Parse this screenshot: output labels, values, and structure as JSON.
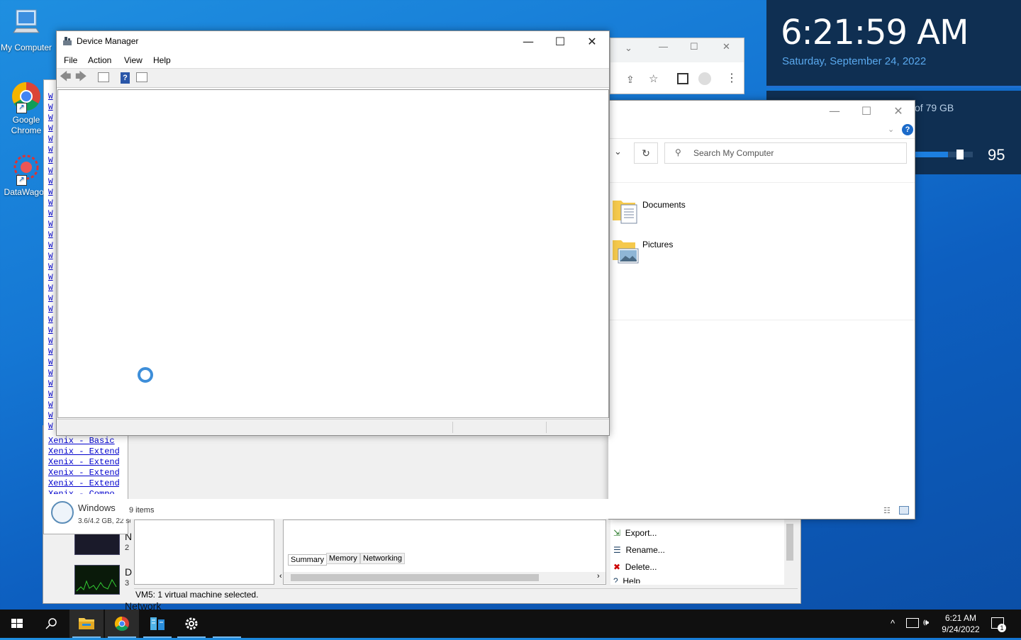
{
  "desktop": {
    "icons": [
      {
        "label": "My Computer",
        "icon": "monitor-icon"
      },
      {
        "label": "Google Chrome",
        "icon": "chrome-icon"
      },
      {
        "label": "DataWagon",
        "icon": "datawagon-icon"
      }
    ]
  },
  "clock_widget": {
    "time": "6:21:59 AM",
    "date": "Saturday, September 24, 2022"
  },
  "disk_widget": {
    "capacity_text": "of 79 GB",
    "volume_value": "95",
    "volume_level_percent": 95
  },
  "device_manager": {
    "title": "Device Manager",
    "menu": [
      "File",
      "Action",
      "View",
      "Help"
    ],
    "controls": {
      "minimize": "—",
      "maximize": "☐",
      "close": "✕"
    }
  },
  "explorer": {
    "search_placeholder": "Search My Computer",
    "items": [
      {
        "label": "Documents",
        "icon": "documents-folder-icon"
      },
      {
        "label": "Pictures",
        "icon": "pictures-folder-icon"
      }
    ],
    "status": "9 items"
  },
  "background_list": {
    "link_glyph": "W",
    "xenix_items": [
      "Xenix - Basic",
      "Xenix - Extend",
      "Xenix - Extend",
      "Xenix - Extend",
      "Xenix - Extend",
      "Xenix - Compo"
    ]
  },
  "windows_tile": {
    "title": "Windows",
    "subtitle": "3.6/4.2 GB, 22 se"
  },
  "hyperv": {
    "tabs": [
      "Summary",
      "Memory",
      "Networking"
    ],
    "actions": [
      "Export...",
      "Rename...",
      "Delete...",
      "Help"
    ],
    "status": "VM5:  1 virtual machine selected.",
    "side_labels": [
      "N",
      "2",
      "D",
      "3",
      "Network"
    ]
  },
  "taskbar": {
    "time": "6:21 AM",
    "date": "9/24/2022",
    "notification_count": "1"
  }
}
